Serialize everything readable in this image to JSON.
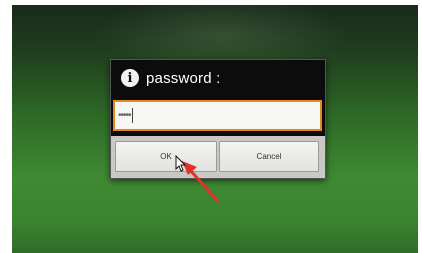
{
  "dialog": {
    "icon": "info-icon",
    "title": "password :",
    "password_value": "•••••",
    "buttons": {
      "ok_label": "OK",
      "cancel_label": "Cancel"
    }
  },
  "colors": {
    "field_border": "#e38a1e",
    "annotation_arrow": "#e0322b",
    "background_green": "#3f8a33"
  },
  "annotation": {
    "icon": "arrow-icon",
    "points_to": "OK"
  }
}
